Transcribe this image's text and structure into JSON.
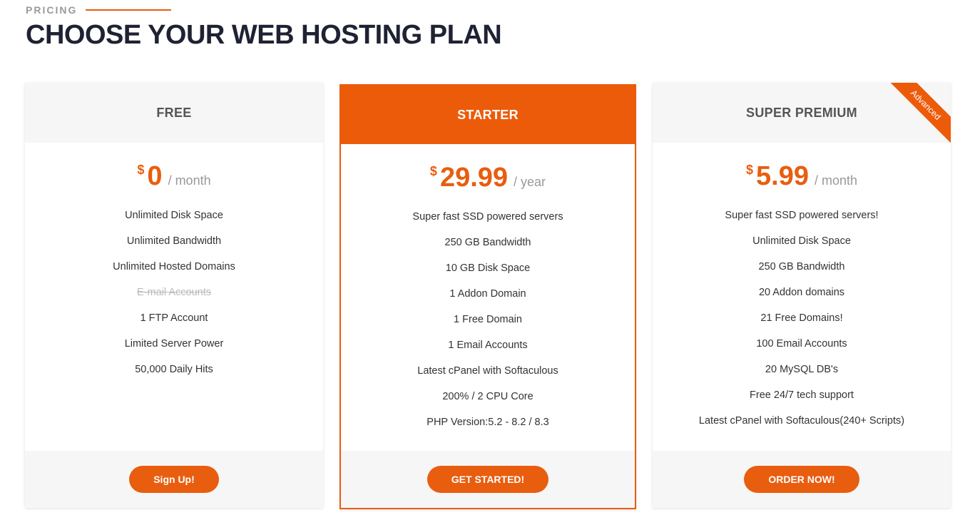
{
  "header": {
    "eyebrow": "PRICING",
    "title": "CHOOSE YOUR WEB HOSTING PLAN"
  },
  "colors": {
    "accent": "#e95d0f",
    "heading": "#1f2233"
  },
  "plans": [
    {
      "name": "FREE",
      "currency": "$",
      "price": "0",
      "period": "/ month",
      "features": [
        "Unlimited Disk Space",
        "Unlimited Bandwidth",
        "Unlimited Hosted Domains",
        "E-mail Accounts",
        "1 FTP Account",
        "Limited Server Power",
        "50,000 Daily Hits"
      ],
      "button": "Sign Up!"
    },
    {
      "name": "STARTER",
      "currency": "$",
      "price": "29.99",
      "period": "/ year",
      "features": [
        "Super fast SSD powered servers",
        "250 GB Bandwidth",
        "10 GB Disk Space",
        "1 Addon Domain",
        "1 Free Domain",
        "1 Email Accounts",
        "Latest cPanel with Softaculous",
        "200% / 2 CPU Core",
        "PHP Version:5.2 - 8.2 / 8.3"
      ],
      "button": "GET STARTED!"
    },
    {
      "name": "SUPER PREMIUM",
      "currency": "$",
      "price": "5.99",
      "period": "/ month",
      "ribbon": "Advanced",
      "features": [
        "Super fast SSD powered servers!",
        "Unlimited Disk Space",
        "250 GB Bandwidth",
        "20 Addon domains",
        "21 Free Domains!",
        "100 Email Accounts",
        "20 MySQL DB's",
        "Free 24/7 tech support",
        "Latest cPanel with Softaculous(240+ Scripts)"
      ],
      "button": "ORDER NOW!"
    }
  ]
}
